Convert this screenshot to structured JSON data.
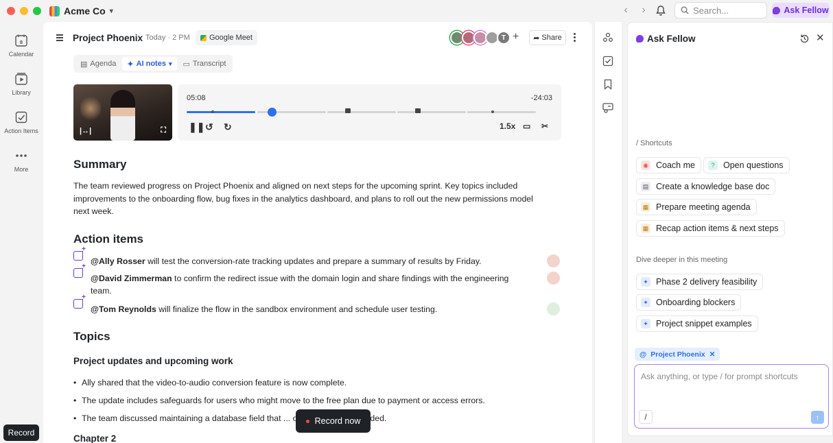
{
  "titlebar": {
    "workspace": "Acme Co",
    "search_placeholder": "Search...",
    "ask_button": "Ask Fellow"
  },
  "leftnav": {
    "items": [
      {
        "label": "Calendar",
        "icon": "calendar-icon"
      },
      {
        "label": "Library",
        "icon": "library-icon"
      },
      {
        "label": "Action Items",
        "icon": "checkbox-icon"
      },
      {
        "label": "More",
        "icon": "more-icon"
      }
    ],
    "record": "Record"
  },
  "meeting": {
    "title": "Project Phoenix",
    "time": "Today · 2 PM",
    "conference": "Google Meet",
    "share": "Share",
    "participant_initial": "T",
    "tabs": [
      "Agenda",
      "AI notes",
      "Transcript"
    ],
    "active_tab": "AI notes",
    "player": {
      "current": "05:08",
      "remaining": "-24:03",
      "speed": "1.5x",
      "progress": 0.24
    },
    "summary_heading": "Summary",
    "summary": "The team reviewed progress on Project Phoenix and aligned on next steps for the upcoming sprint. Key topics included improvements to the onboarding flow, bug fixes in the analytics dashboard, and plans to roll out the new permissions model next week.",
    "action_heading": "Action items",
    "action_items": [
      {
        "mention": "@Ally Rosser",
        "text": " will test the conversion-rate tracking updates and prepare a summary of results by Friday."
      },
      {
        "mention": "@David Zimmerman",
        "text": " to confirm the redirect issue with the domain login and share findings with the engineering team."
      },
      {
        "mention": "@Tom Reynolds",
        "text": " will finalize the flow in the sandbox environment and schedule user testing."
      }
    ],
    "topics_heading": "Topics",
    "topic_title": "Project updates and upcoming work",
    "bullets": [
      "Ally shared that the video-to-audio conversion feature is now complete.",
      "The update includes safeguards for users who might move to the free plan due to payment or access errors.",
      "The team discussed maintaining a database field that ... of conversions if needed."
    ],
    "next_heading": "Chapter 2",
    "record_now": "Record now"
  },
  "panel": {
    "title": "Ask Fellow",
    "shortcuts_label": "/ Shortcuts",
    "shortcuts": [
      "Coach me",
      "Open questions",
      "Create a knowledge base doc",
      "Prepare meeting agenda",
      "Recap action items & next steps"
    ],
    "deeper_label": "Dive deeper in this meeting",
    "deeper": [
      "Phase 2 delivery feasibility",
      "Onboarding blockers",
      "Project snippet examples"
    ],
    "context_pill": "Project Phoenix",
    "composer_placeholder": "Ask anything, or type / for prompt shortcuts"
  },
  "colors": {
    "accent": "#2f6fed",
    "brand_purple": "#7b3fe4"
  }
}
